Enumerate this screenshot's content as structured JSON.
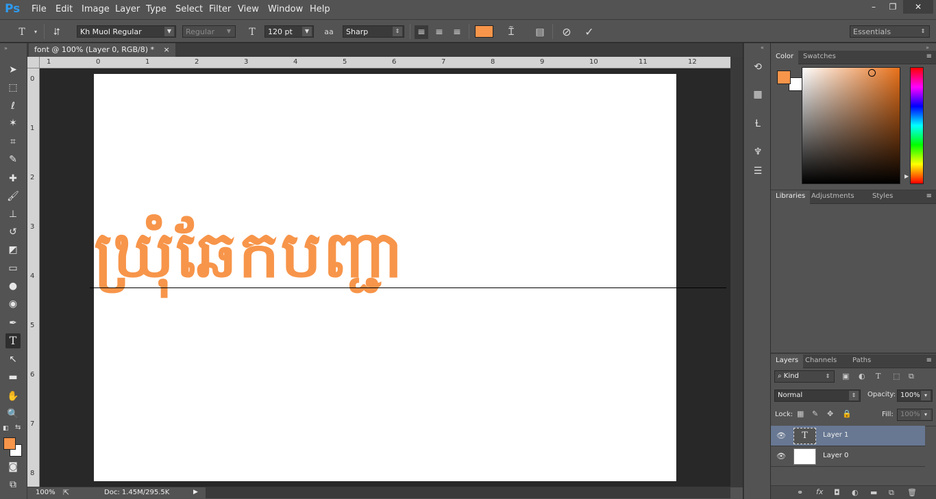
{
  "menubar": {
    "logo": "Ps",
    "items": [
      "File",
      "Edit",
      "Image",
      "Layer",
      "Type",
      "Select",
      "Filter",
      "View",
      "Window",
      "Help"
    ],
    "window_controls": [
      "–",
      "❐",
      "✕"
    ]
  },
  "options": {
    "font_family": "Kh Muol Regular",
    "font_style": "Regular",
    "font_size": "120 pt",
    "antialias_label": "aa",
    "antialias": "Sharp",
    "text_color": "#f7954a",
    "workspace": "Essentials"
  },
  "document": {
    "tab_title": "font @ 100% (Layer 0, RGB/8) *",
    "tab_close": "×",
    "canvas_text": "ឃ្រុំឆែកបញ្ជា",
    "zoom": "100%",
    "doc_info": "Doc: 1.45M/295.5K",
    "ruler_h": [
      "1",
      "0",
      "1",
      "2",
      "3",
      "4",
      "5",
      "6",
      "7",
      "8",
      "9",
      "10",
      "11",
      "12"
    ],
    "ruler_v": [
      "0",
      "1",
      "2",
      "3",
      "4",
      "5",
      "6",
      "7",
      "8"
    ]
  },
  "color_panel": {
    "tabs": [
      "Color",
      "Swatches"
    ],
    "foreground": "#f7954a",
    "background": "#ffffff"
  },
  "libraries_panel": {
    "tabs": [
      "Libraries",
      "Adjustments",
      "Styles"
    ]
  },
  "layers_panel": {
    "tabs": [
      "Layers",
      "Channels",
      "Paths"
    ],
    "filter_kind": "Kind",
    "blend_mode": "Normal",
    "opacity_label": "Opacity:",
    "opacity": "100%",
    "lock_label": "Lock:",
    "fill_label": "Fill:",
    "fill": "100%",
    "layers": [
      {
        "name": "Layer 1",
        "type": "text",
        "selected": true
      },
      {
        "name": "Layer 0",
        "type": "image",
        "selected": false
      }
    ]
  }
}
